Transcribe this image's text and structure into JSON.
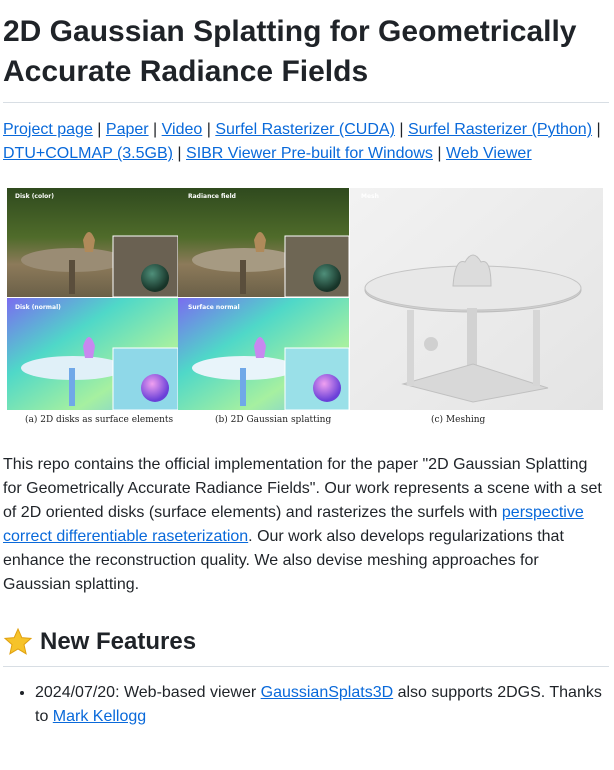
{
  "title": "2D Gaussian Splatting for Geometrically Accurate Radiance Fields",
  "links": [
    {
      "label": "Project page",
      "sep": " | "
    },
    {
      "label": "Paper",
      "sep": " | "
    },
    {
      "label": "Video",
      "sep": " | "
    },
    {
      "label": "Surfel Rasterizer (CUDA)",
      "sep": " | "
    },
    {
      "label": "Surfel Rasterizer (Python)",
      "sep": " | "
    },
    {
      "label": "DTU+COLMAP (3.5GB)",
      "sep": " | "
    },
    {
      "label": "SIBR Viewer Pre-built for Windows",
      "sep": " | "
    },
    {
      "label": "Web Viewer",
      "sep": ""
    }
  ],
  "figure": {
    "panel_labels": [
      "Disk (color)",
      "Radiance field",
      "Disk (normal)",
      "Surface normal",
      "Mesh"
    ],
    "captions": [
      "(a) 2D disks as surface elements",
      "(b) 2D Gaussian splatting",
      "(c) Meshing"
    ]
  },
  "description": {
    "text_before": "This repo contains the official implementation for the paper \"2D Gaussian Splatting for Geometrically Accurate Radiance Fields\". Our work represents a scene with a set of 2D oriented disks (surface elements) and rasterizes the surfels with ",
    "link": "perspective correct differentiable raseterization",
    "text_after": ". Our work also develops regularizations that enhance the reconstruction quality. We also devise meshing approaches for Gaussian splatting."
  },
  "new_features": {
    "heading": "New Features",
    "icon": "star-icon",
    "items": [
      {
        "prefix": "2024/07/20: Web-based viewer ",
        "link1": "GaussianSplats3D",
        "middle": " also supports 2DGS. Thanks to ",
        "link2": "Mark Kellogg"
      }
    ]
  },
  "colors": {
    "link": "#0969da",
    "text": "#1f2328",
    "divider": "#d8dee4",
    "star": "#f6c32a"
  }
}
